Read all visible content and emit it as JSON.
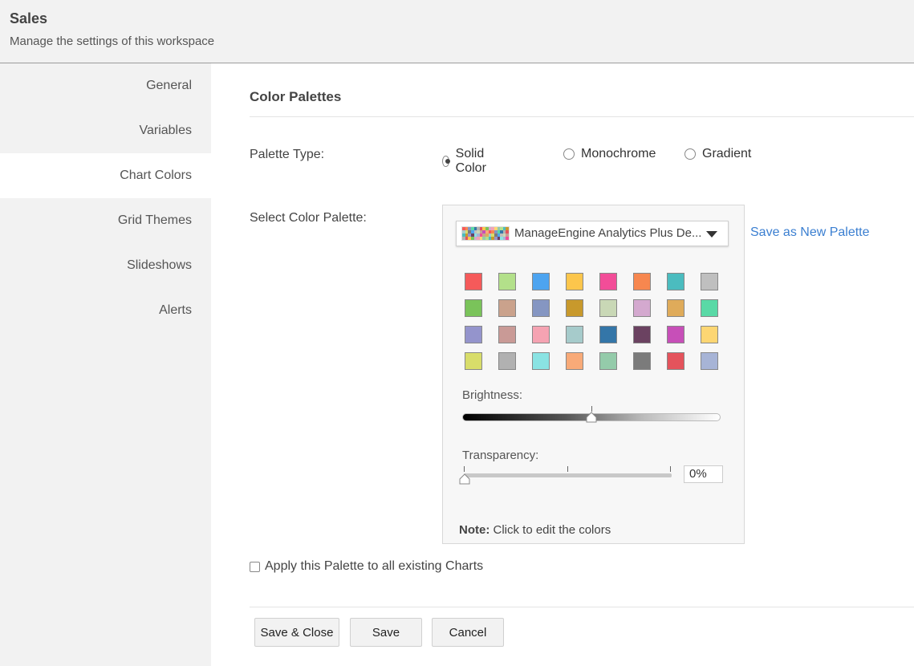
{
  "header": {
    "title": "Sales",
    "subtitle": "Manage the settings of this workspace"
  },
  "sidebar": {
    "items": [
      {
        "label": "General",
        "active": false
      },
      {
        "label": "Variables",
        "active": false
      },
      {
        "label": "Chart Colors",
        "active": true
      },
      {
        "label": "Grid Themes",
        "active": false
      },
      {
        "label": "Slideshows",
        "active": false
      },
      {
        "label": "Alerts",
        "active": false
      }
    ]
  },
  "main": {
    "section_title": "Color Palettes",
    "palette_type": {
      "label": "Palette Type:",
      "options": [
        {
          "label": "Solid Color",
          "checked": true
        },
        {
          "label": "Monochrome",
          "checked": false
        },
        {
          "label": "Gradient",
          "checked": false
        }
      ]
    },
    "select_palette": {
      "label": "Select Color Palette:",
      "dropdown_value": "ManageEngine Analytics Plus De...",
      "save_new_link": "Save as New Palette",
      "colors": [
        "#f55a5a",
        "#b3e08a",
        "#4da4f0",
        "#fcc64c",
        "#f24d98",
        "#f7874f",
        "#4bbcbf",
        "#bfbfbf",
        "#7ac35a",
        "#caa28c",
        "#8596c2",
        "#c8992c",
        "#c9d8b6",
        "#d4a9cf",
        "#dfab5a",
        "#59d9a6",
        "#9494cc",
        "#c99a96",
        "#f5a3b2",
        "#a6cbcb",
        "#3476a8",
        "#6b4261",
        "#c74fb8",
        "#fdd673",
        "#d8dd6a",
        "#b1b1b1",
        "#8ae3e3",
        "#f8aa78",
        "#94cbaa",
        "#7b7b7b",
        "#e4535c",
        "#a7b4d6"
      ],
      "brightness_label": "Brightness:",
      "brightness_value": 0.5,
      "transparency_label": "Transparency:",
      "transparency_value": "0%",
      "note_label": "Note:",
      "note_text": " Click to edit the colors"
    },
    "apply_all_label": "Apply this Palette to all existing Charts",
    "buttons": {
      "save_close": "Save & Close",
      "save": "Save",
      "cancel": "Cancel"
    }
  }
}
